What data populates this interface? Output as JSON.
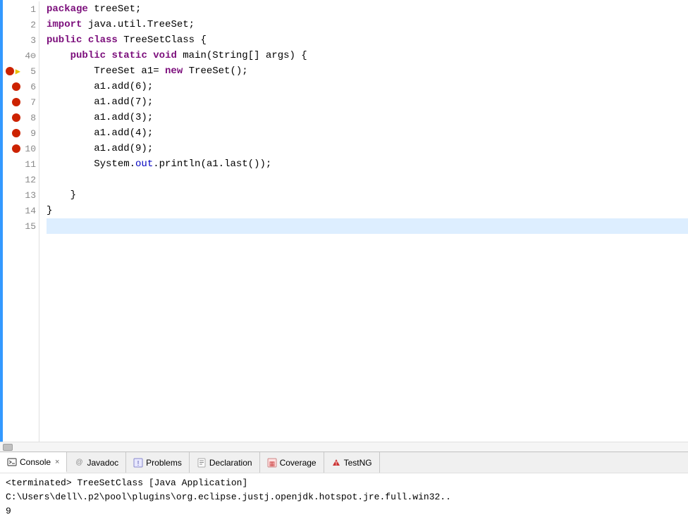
{
  "editor": {
    "lines": [
      {
        "num": "1",
        "content_html": "<span class='kw'>package</span> treeSet;",
        "hasBreakpoint": false,
        "hasArrow": false,
        "highlighted": false
      },
      {
        "num": "2",
        "content_html": "<span class='kw'>import</span> java.util.TreeSet;",
        "hasBreakpoint": false,
        "hasArrow": false,
        "highlighted": false
      },
      {
        "num": "3",
        "content_html": "<span class='kw'>public</span> <span class='kw'>class</span> TreeSetClass {",
        "hasBreakpoint": false,
        "hasArrow": false,
        "highlighted": false
      },
      {
        "num": "4⊖",
        "content_html": "    <span class='kw'>public</span> <span class='kw'>static</span> <span class='kw'>void</span> main(String[] args) {",
        "hasBreakpoint": false,
        "hasArrow": false,
        "highlighted": false
      },
      {
        "num": "5",
        "content_html": "        TreeSet a1= <span class='kw'>new</span> TreeSet();",
        "hasBreakpoint": true,
        "hasArrow": true,
        "highlighted": false
      },
      {
        "num": "6",
        "content_html": "        a1.add(6);",
        "hasBreakpoint": true,
        "hasArrow": false,
        "highlighted": false
      },
      {
        "num": "7",
        "content_html": "        a1.add(7);",
        "hasBreakpoint": true,
        "hasArrow": false,
        "highlighted": false
      },
      {
        "num": "8",
        "content_html": "        a1.add(3);",
        "hasBreakpoint": true,
        "hasArrow": false,
        "highlighted": false
      },
      {
        "num": "9",
        "content_html": "        a1.add(4);",
        "hasBreakpoint": true,
        "hasArrow": false,
        "highlighted": false
      },
      {
        "num": "10",
        "content_html": "        a1.add(9);",
        "hasBreakpoint": true,
        "hasArrow": false,
        "highlighted": false
      },
      {
        "num": "11",
        "content_html": "        System.<span class='field'>out</span>.println(a1.last());",
        "hasBreakpoint": false,
        "hasArrow": false,
        "highlighted": false
      },
      {
        "num": "12",
        "content_html": "",
        "hasBreakpoint": false,
        "hasArrow": false,
        "highlighted": false
      },
      {
        "num": "13",
        "content_html": "    }",
        "hasBreakpoint": false,
        "hasArrow": false,
        "highlighted": false
      },
      {
        "num": "14",
        "content_html": "}",
        "hasBreakpoint": false,
        "hasArrow": false,
        "highlighted": false
      },
      {
        "num": "15",
        "content_html": "",
        "hasBreakpoint": false,
        "hasArrow": false,
        "highlighted": true
      }
    ]
  },
  "tabs": [
    {
      "id": "console",
      "label": "Console",
      "active": true,
      "closeable": true,
      "icon": "console"
    },
    {
      "id": "javadoc",
      "label": "Javadoc",
      "active": false,
      "closeable": false,
      "icon": "javadoc"
    },
    {
      "id": "problems",
      "label": "Problems",
      "active": false,
      "closeable": false,
      "icon": "problems"
    },
    {
      "id": "declaration",
      "label": "Declaration",
      "active": false,
      "closeable": false,
      "icon": "declaration"
    },
    {
      "id": "coverage",
      "label": "Coverage",
      "active": false,
      "closeable": false,
      "icon": "coverage"
    },
    {
      "id": "testng",
      "label": "TestNG",
      "active": false,
      "closeable": false,
      "icon": "testng"
    }
  ],
  "console": {
    "terminated_line": "<terminated> TreeSetClass [Java Application] C:\\Users\\dell\\.p2\\pool\\plugins\\org.eclipse.justj.openjdk.hotspot.jre.full.win32..",
    "output_line": "9"
  }
}
